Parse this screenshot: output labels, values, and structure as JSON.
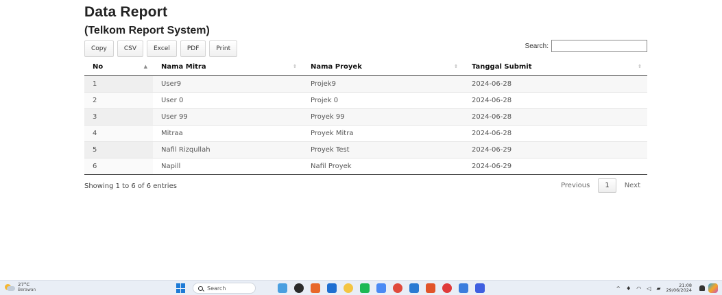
{
  "page": {
    "title": "Data Report",
    "subtitle": "(Telkom Report System)"
  },
  "toolbar": {
    "buttons": [
      "Copy",
      "CSV",
      "Excel",
      "PDF",
      "Print"
    ],
    "search_label": "Search:",
    "search_value": ""
  },
  "table": {
    "columns": [
      "No",
      "Nama Mitra",
      "Nama Proyek",
      "Tanggal Submit"
    ],
    "rows": [
      [
        "1",
        "User9",
        "Projek9",
        "2024-06-28"
      ],
      [
        "2",
        "User 0",
        "Projek 0",
        "2024-06-28"
      ],
      [
        "3",
        "User 99",
        "Proyek 99",
        "2024-06-28"
      ],
      [
        "4",
        "Mitraa",
        "Proyek Mitra",
        "2024-06-28"
      ],
      [
        "5",
        "Nafil Rizqullah",
        "Proyek Test",
        "2024-06-29"
      ],
      [
        "6",
        "Napill",
        "Nafil Proyek",
        "2024-06-29"
      ]
    ]
  },
  "footer": {
    "info": "Showing 1 to 6 of 6 entries",
    "previous": "Previous",
    "current_page": "1",
    "next": "Next"
  },
  "taskbar": {
    "weather_temp": "27°C",
    "weather_condition": "Berawan",
    "search_label": "Search",
    "apps": [
      {
        "name": "photos-app-icon",
        "color": "#4a9fe0"
      },
      {
        "name": "terminal-app-icon",
        "color": "#2b2b2b"
      },
      {
        "name": "office-app-icon",
        "color": "#e8672a"
      },
      {
        "name": "store-app-icon",
        "color": "#1f6fd1"
      },
      {
        "name": "file-explorer-icon",
        "color": "#f4c542"
      },
      {
        "name": "spotify-icon",
        "color": "#1db954"
      },
      {
        "name": "chrome-icon",
        "color": "#4a8af4"
      },
      {
        "name": "chrome-profile-icon",
        "color": "#e04a3c"
      },
      {
        "name": "vscode-icon",
        "color": "#2a7bd3"
      },
      {
        "name": "outlook-icon",
        "color": "#e1542a"
      },
      {
        "name": "opera-icon",
        "color": "#e03a3a"
      },
      {
        "name": "chrome-dev-icon",
        "color": "#3b7ddd"
      },
      {
        "name": "app-blue-icon",
        "color": "#3f5fe0"
      }
    ],
    "time": "21:08",
    "date": "29/06/2024"
  }
}
